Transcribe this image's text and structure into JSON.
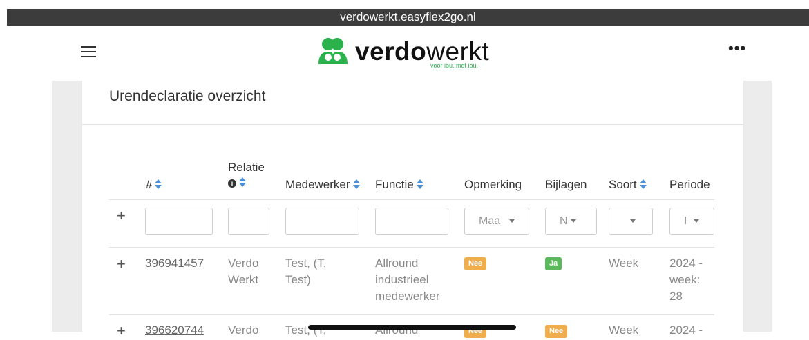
{
  "browser": {
    "url": "verdowerkt.easyflex2go.nl"
  },
  "header": {
    "logo_bold": "verdo",
    "logo_light": "werkt",
    "logo_tagline": "voor iou. met iou.",
    "menu_icon": "hamburger-icon",
    "more_label": "•••"
  },
  "page": {
    "title": "Urendeclaratie overzicht"
  },
  "table": {
    "columns": {
      "num": "#",
      "relatie": "Relatie",
      "medewerker": "Medewerker",
      "functie": "Functie",
      "opmerking": "Opmerking",
      "bijlagen": "Bijlagen",
      "soort": "Soort",
      "periode": "Periode"
    },
    "filters": {
      "plus": "+",
      "opmerking_value": "Maa",
      "bijlagen_value": "N",
      "soort_value": "",
      "periode_value": "I"
    },
    "rows": [
      {
        "plus": "+",
        "id": "396941457",
        "relatie_1": "Verdo",
        "relatie_2": "Werkt",
        "medewerker_1": "Test, (T,",
        "medewerker_2": "Test)",
        "functie_1": "Allround",
        "functie_2": "industrieel",
        "functie_3": "medewerker",
        "opmerking": "Nee",
        "bijlagen": "Ja",
        "soort": "Week",
        "periode_1": "2024 -",
        "periode_2": "week:",
        "periode_3": "28"
      },
      {
        "plus": "+",
        "id": "396620744",
        "relatie_1": "Verdo",
        "medewerker_1": "Test, (T,",
        "functie_1": "Allround",
        "opmerking": "Nee",
        "bijlagen": "Nee",
        "soort": "Week",
        "periode_1": "2024 -"
      }
    ]
  },
  "colors": {
    "brand_green": "#2bb24c",
    "badge_orange": "#f0ad4e",
    "badge_green": "#5cb85c",
    "sort_blue": "#4a90d9"
  }
}
